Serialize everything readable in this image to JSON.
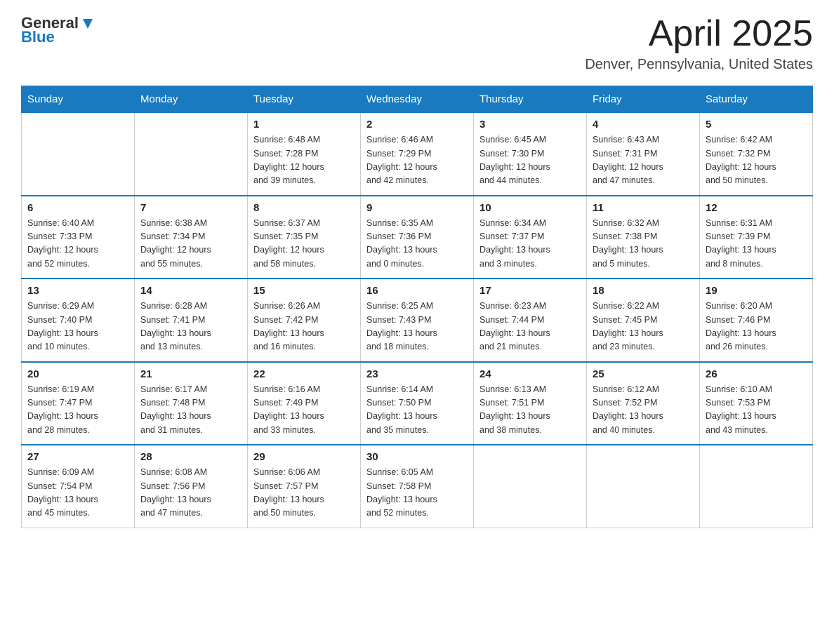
{
  "header": {
    "logo_general": "General",
    "logo_blue": "Blue",
    "month_title": "April 2025",
    "location": "Denver, Pennsylvania, United States"
  },
  "weekdays": [
    "Sunday",
    "Monday",
    "Tuesday",
    "Wednesday",
    "Thursday",
    "Friday",
    "Saturday"
  ],
  "weeks": [
    [
      {
        "day": "",
        "info": ""
      },
      {
        "day": "",
        "info": ""
      },
      {
        "day": "1",
        "info": "Sunrise: 6:48 AM\nSunset: 7:28 PM\nDaylight: 12 hours\nand 39 minutes."
      },
      {
        "day": "2",
        "info": "Sunrise: 6:46 AM\nSunset: 7:29 PM\nDaylight: 12 hours\nand 42 minutes."
      },
      {
        "day": "3",
        "info": "Sunrise: 6:45 AM\nSunset: 7:30 PM\nDaylight: 12 hours\nand 44 minutes."
      },
      {
        "day": "4",
        "info": "Sunrise: 6:43 AM\nSunset: 7:31 PM\nDaylight: 12 hours\nand 47 minutes."
      },
      {
        "day": "5",
        "info": "Sunrise: 6:42 AM\nSunset: 7:32 PM\nDaylight: 12 hours\nand 50 minutes."
      }
    ],
    [
      {
        "day": "6",
        "info": "Sunrise: 6:40 AM\nSunset: 7:33 PM\nDaylight: 12 hours\nand 52 minutes."
      },
      {
        "day": "7",
        "info": "Sunrise: 6:38 AM\nSunset: 7:34 PM\nDaylight: 12 hours\nand 55 minutes."
      },
      {
        "day": "8",
        "info": "Sunrise: 6:37 AM\nSunset: 7:35 PM\nDaylight: 12 hours\nand 58 minutes."
      },
      {
        "day": "9",
        "info": "Sunrise: 6:35 AM\nSunset: 7:36 PM\nDaylight: 13 hours\nand 0 minutes."
      },
      {
        "day": "10",
        "info": "Sunrise: 6:34 AM\nSunset: 7:37 PM\nDaylight: 13 hours\nand 3 minutes."
      },
      {
        "day": "11",
        "info": "Sunrise: 6:32 AM\nSunset: 7:38 PM\nDaylight: 13 hours\nand 5 minutes."
      },
      {
        "day": "12",
        "info": "Sunrise: 6:31 AM\nSunset: 7:39 PM\nDaylight: 13 hours\nand 8 minutes."
      }
    ],
    [
      {
        "day": "13",
        "info": "Sunrise: 6:29 AM\nSunset: 7:40 PM\nDaylight: 13 hours\nand 10 minutes."
      },
      {
        "day": "14",
        "info": "Sunrise: 6:28 AM\nSunset: 7:41 PM\nDaylight: 13 hours\nand 13 minutes."
      },
      {
        "day": "15",
        "info": "Sunrise: 6:26 AM\nSunset: 7:42 PM\nDaylight: 13 hours\nand 16 minutes."
      },
      {
        "day": "16",
        "info": "Sunrise: 6:25 AM\nSunset: 7:43 PM\nDaylight: 13 hours\nand 18 minutes."
      },
      {
        "day": "17",
        "info": "Sunrise: 6:23 AM\nSunset: 7:44 PM\nDaylight: 13 hours\nand 21 minutes."
      },
      {
        "day": "18",
        "info": "Sunrise: 6:22 AM\nSunset: 7:45 PM\nDaylight: 13 hours\nand 23 minutes."
      },
      {
        "day": "19",
        "info": "Sunrise: 6:20 AM\nSunset: 7:46 PM\nDaylight: 13 hours\nand 26 minutes."
      }
    ],
    [
      {
        "day": "20",
        "info": "Sunrise: 6:19 AM\nSunset: 7:47 PM\nDaylight: 13 hours\nand 28 minutes."
      },
      {
        "day": "21",
        "info": "Sunrise: 6:17 AM\nSunset: 7:48 PM\nDaylight: 13 hours\nand 31 minutes."
      },
      {
        "day": "22",
        "info": "Sunrise: 6:16 AM\nSunset: 7:49 PM\nDaylight: 13 hours\nand 33 minutes."
      },
      {
        "day": "23",
        "info": "Sunrise: 6:14 AM\nSunset: 7:50 PM\nDaylight: 13 hours\nand 35 minutes."
      },
      {
        "day": "24",
        "info": "Sunrise: 6:13 AM\nSunset: 7:51 PM\nDaylight: 13 hours\nand 38 minutes."
      },
      {
        "day": "25",
        "info": "Sunrise: 6:12 AM\nSunset: 7:52 PM\nDaylight: 13 hours\nand 40 minutes."
      },
      {
        "day": "26",
        "info": "Sunrise: 6:10 AM\nSunset: 7:53 PM\nDaylight: 13 hours\nand 43 minutes."
      }
    ],
    [
      {
        "day": "27",
        "info": "Sunrise: 6:09 AM\nSunset: 7:54 PM\nDaylight: 13 hours\nand 45 minutes."
      },
      {
        "day": "28",
        "info": "Sunrise: 6:08 AM\nSunset: 7:56 PM\nDaylight: 13 hours\nand 47 minutes."
      },
      {
        "day": "29",
        "info": "Sunrise: 6:06 AM\nSunset: 7:57 PM\nDaylight: 13 hours\nand 50 minutes."
      },
      {
        "day": "30",
        "info": "Sunrise: 6:05 AM\nSunset: 7:58 PM\nDaylight: 13 hours\nand 52 minutes."
      },
      {
        "day": "",
        "info": ""
      },
      {
        "day": "",
        "info": ""
      },
      {
        "day": "",
        "info": ""
      }
    ]
  ]
}
